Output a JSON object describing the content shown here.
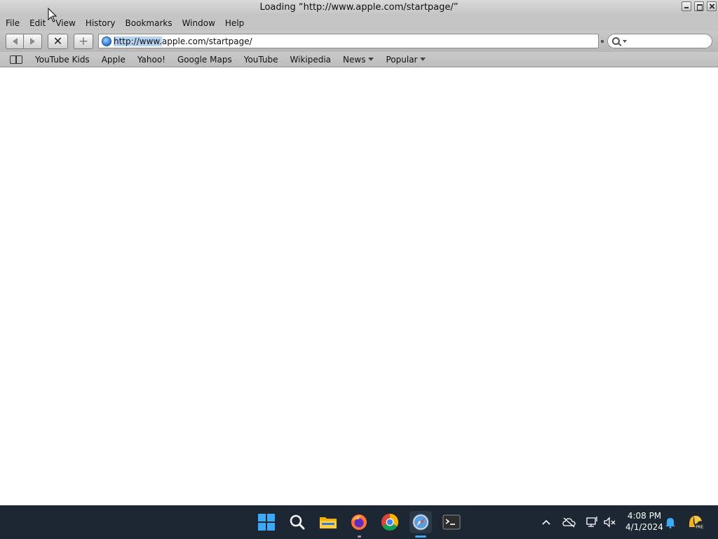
{
  "window": {
    "title": "Loading “http://www.apple.com/startpage/”"
  },
  "menu": {
    "items": [
      "File",
      "Edit",
      "View",
      "History",
      "Bookmarks",
      "Window",
      "Help"
    ]
  },
  "toolbar": {
    "url_selected": "http://www.",
    "url_rest": "apple.com/startpage/",
    "back_icon": "back-arrow-icon",
    "forward_icon": "forward-arrow-icon",
    "stop_icon": "stop-x-icon",
    "add_icon": "plus-icon"
  },
  "search": {
    "placeholder": ""
  },
  "bookmarks": {
    "items": [
      "YouTube Kids",
      "Apple",
      "Yahoo!",
      "Google Maps",
      "YouTube",
      "Wikipedia"
    ],
    "menus": [
      "News",
      "Popular"
    ]
  },
  "taskbar": {
    "apps": [
      "start",
      "search",
      "file-explorer",
      "firefox",
      "chrome",
      "safari",
      "terminal"
    ],
    "active_app": "safari",
    "time": "4:08 PM",
    "date": "4/1/2024",
    "colors": {
      "background": "#1c2733",
      "accent": "#3ea9f5"
    }
  }
}
